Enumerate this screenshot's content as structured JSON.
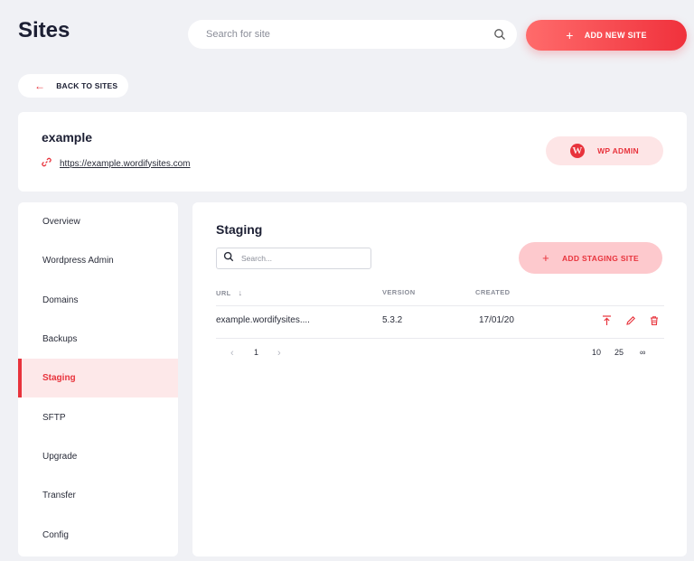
{
  "header": {
    "title": "Sites",
    "search_placeholder": "Search for site",
    "add_button_label": "ADD NEW SITE"
  },
  "back_button_label": "BACK TO SITES",
  "site": {
    "name": "example",
    "url": "https://example.wordifysites.com",
    "wp_admin_label": "WP ADMIN"
  },
  "sidebar": {
    "items": [
      {
        "label": "Overview"
      },
      {
        "label": "Wordpress Admin"
      },
      {
        "label": "Domains"
      },
      {
        "label": "Backups"
      },
      {
        "label": "Staging"
      },
      {
        "label": "SFTP"
      },
      {
        "label": "Upgrade"
      },
      {
        "label": "Transfer"
      },
      {
        "label": "Config"
      }
    ],
    "active": "Staging"
  },
  "staging": {
    "title": "Staging",
    "search_placeholder": "Search...",
    "add_button_label": "ADD STAGING SITE",
    "columns": [
      "URL",
      "VERSION",
      "CREATED"
    ],
    "rows": [
      {
        "url": "example.wordifysites....",
        "version": "5.3.2",
        "created": "17/01/20"
      }
    ],
    "pagination": {
      "current_page": "1",
      "page_sizes": [
        "10",
        "25",
        "∞"
      ]
    }
  },
  "colors": {
    "accent": "#e8333c",
    "accent_light": "#fde8e9",
    "background": "#f0f1f5"
  }
}
